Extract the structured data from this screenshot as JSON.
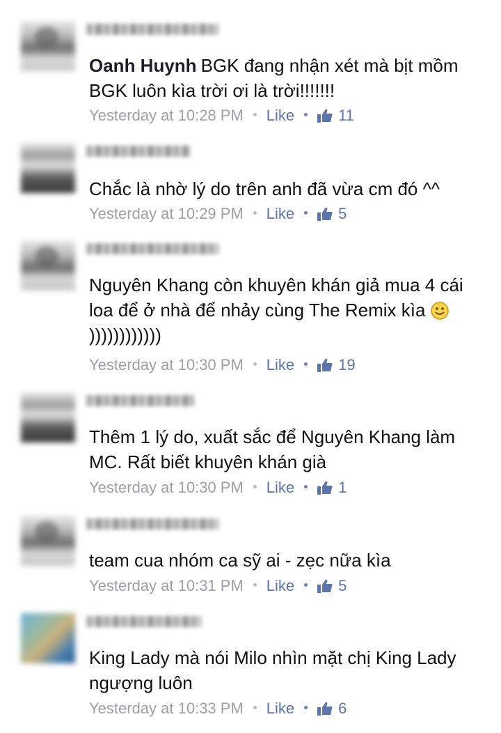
{
  "comments": [
    {
      "author": "Oanh Huynh",
      "text": "BGK đang nhận xét mà bịt mồm BGK luôn kìa trời ơi là trời!!!!!!!",
      "time": "Yesterday at 10:28 PM",
      "like": "Like",
      "likes": "11",
      "avatar": "a"
    },
    {
      "author": "",
      "text": "Chắc là nhờ lý do trên anh đã vừa cm đó ^^",
      "time": "Yesterday at 10:29 PM",
      "like": "Like",
      "likes": "5",
      "avatar": "b"
    },
    {
      "author": "",
      "text": "Nguyên Khang còn khuyên khán giả mua 4 cái loa để ở nhà để nhảy cùng The Remix kìa",
      "text_after_emoji": "))))))))))))",
      "time": "Yesterday at 10:30 PM",
      "like": "Like",
      "likes": "19",
      "avatar": "a"
    },
    {
      "author": "",
      "text": "Thêm 1 lý do, xuất sắc để Nguyên Khang làm MC. Rất biết khuyên khán già",
      "time": "Yesterday at 10:30 PM",
      "like": "Like",
      "likes": "1",
      "avatar": "b"
    },
    {
      "author": "",
      "text": "team cua nhóm ca sỹ ai - zẹc nữa kìa",
      "time": "Yesterday at 10:31 PM",
      "like": "Like",
      "likes": "5",
      "avatar": "a"
    },
    {
      "author": "",
      "text": "King Lady mà nói Milo nhìn mặt chị King Lady ngượng luôn",
      "time": "Yesterday at 10:33 PM",
      "like": "Like",
      "likes": "6",
      "avatar": "c"
    }
  ],
  "icons": {
    "like_thumb": "thumbs-up-icon",
    "emoji": "smiley-icon"
  },
  "colors": {
    "link": "#5b74aa",
    "meta": "#9aa0a8",
    "text": "#111111"
  }
}
